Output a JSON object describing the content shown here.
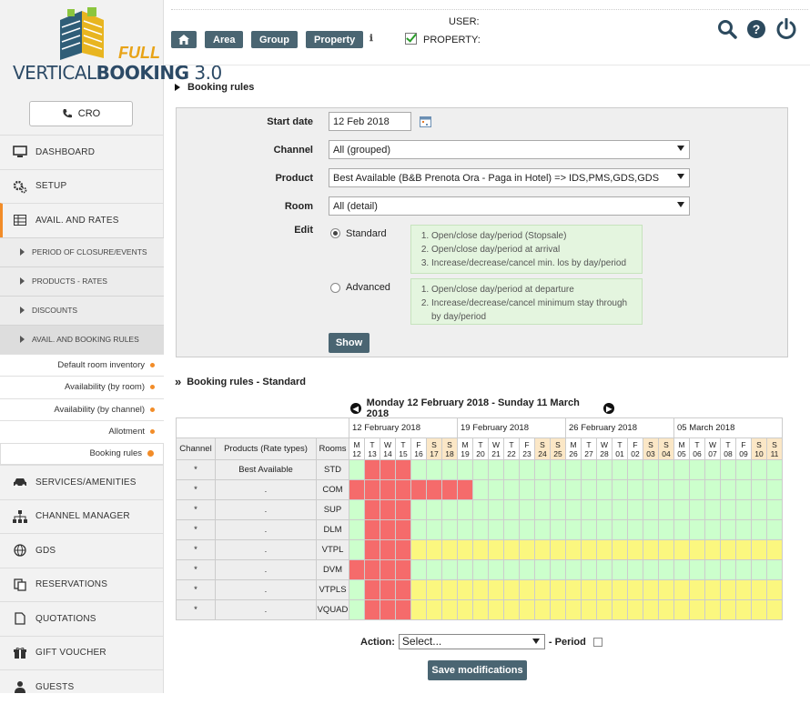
{
  "brand": {
    "name_light": "VERTICAL",
    "name_bold": "BOOKING",
    "version": "3.0",
    "badge": "FULL"
  },
  "cro_label": "CRO",
  "menu": {
    "dashboard": "DASHBOARD",
    "setup": "SETUP",
    "avail_rates": "AVAIL. AND RATES",
    "subs": [
      "PERIOD OF CLOSURE/EVENTS",
      "PRODUCTS - RATES",
      "DISCOUNTS",
      "AVAIL. AND BOOKING RULES"
    ],
    "subsubs": [
      "Default room inventory",
      "Availability (by room)",
      "Availability (by channel)",
      "Allotment",
      "Booking rules"
    ],
    "services": "SERVICES/AMENITIES",
    "channel": "CHANNEL MANAGER",
    "gds": "GDS",
    "reservations": "RESERVATIONS",
    "quotations": "QUOTATIONS",
    "voucher": "GIFT VOUCHER",
    "guests": "GUESTS"
  },
  "topbar": {
    "area": "Area",
    "group": "Group",
    "property": "Property",
    "user_label": "USER:",
    "property_label": "PROPERTY:"
  },
  "section1": "Booking rules",
  "form": {
    "start_label": "Start date",
    "start_value": "12 Feb 2018",
    "channel_label": "Channel",
    "channel_value": "All (grouped)",
    "product_label": "Product",
    "product_value": "Best Available (B&B Prenota Ora - Paga in Hotel)  => IDS,PMS,GDS,GDS",
    "room_label": "Room",
    "room_value": "All (detail)",
    "edit_label": "Edit",
    "standard": "Standard",
    "advanced": "Advanced",
    "std_notes": [
      "Open/close day/period (Stopsale)",
      "Open/close day/period at arrival",
      "Increase/decrease/cancel min. los by day/period"
    ],
    "adv_notes": [
      "Open/close day/period at departure",
      "Increase/decrease/cancel minimum stay through by day/period"
    ],
    "show": "Show"
  },
  "section2": "Booking rules - Standard",
  "range": "Monday 12 February 2018 - Sunday 11 March 2018",
  "grid": {
    "weeks": [
      "12 February 2018",
      "19 February 2018",
      "26 February 2018",
      "05 March 2018"
    ],
    "col_channel": "Channel",
    "col_products": "Products (Rate types)",
    "col_rooms": "Rooms",
    "days": [
      [
        "M",
        "12"
      ],
      [
        "T",
        "13"
      ],
      [
        "W",
        "14"
      ],
      [
        "T",
        "15"
      ],
      [
        "F",
        "16"
      ],
      [
        "S",
        "17"
      ],
      [
        "S",
        "18"
      ],
      [
        "M",
        "19"
      ],
      [
        "T",
        "20"
      ],
      [
        "W",
        "21"
      ],
      [
        "T",
        "22"
      ],
      [
        "F",
        "23"
      ],
      [
        "S",
        "24"
      ],
      [
        "S",
        "25"
      ],
      [
        "M",
        "26"
      ],
      [
        "T",
        "27"
      ],
      [
        "W",
        "28"
      ],
      [
        "T",
        "01"
      ],
      [
        "F",
        "02"
      ],
      [
        "S",
        "03"
      ],
      [
        "S",
        "04"
      ],
      [
        "M",
        "05"
      ],
      [
        "T",
        "06"
      ],
      [
        "W",
        "07"
      ],
      [
        "T",
        "08"
      ],
      [
        "F",
        "09"
      ],
      [
        "S",
        "10"
      ],
      [
        "S",
        "11"
      ]
    ],
    "rows": [
      {
        "channel": "*",
        "product": "Best Available",
        "room": "STD",
        "cells": "grrrgggggggggggggggggggggggg"
      },
      {
        "channel": "*",
        "product": ".",
        "room": "COM",
        "cells": "rrrrrrrrgggggggggggggggggggg"
      },
      {
        "channel": "*",
        "product": ".",
        "room": "SUP",
        "cells": "grrrgggggggggggggggggggggggg"
      },
      {
        "channel": "*",
        "product": ".",
        "room": "DLM",
        "cells": "grrrgggggggggggggggggggggggg"
      },
      {
        "channel": "*",
        "product": ".",
        "room": "VTPL",
        "cells": "grrryyyyyyyyyyyyyyyyyyyyyyyy"
      },
      {
        "channel": "*",
        "product": ".",
        "room": "DVM",
        "cells": "rrrrgggggggggggggggggggggggg"
      },
      {
        "channel": "*",
        "product": ".",
        "room": "VTPLS",
        "cells": "grrryyyyyyyyyyyyyyyyyyyyyyyy"
      },
      {
        "channel": "*",
        "product": ".",
        "room": "VQUAD",
        "cells": "grrryyyyyyyyyyyyyyyyyyyyyyyy"
      }
    ]
  },
  "action": {
    "label": "Action:",
    "select": "Select...",
    "period": "- Period",
    "save": "Save modifications"
  }
}
